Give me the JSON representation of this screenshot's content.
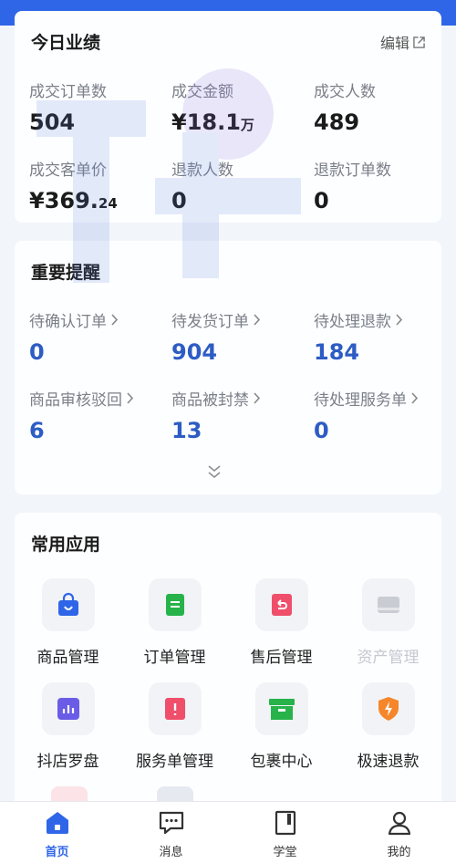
{
  "performance": {
    "title": "今日业绩",
    "edit_label": "编辑",
    "metrics": [
      {
        "label": "成交订单数",
        "value": "504",
        "suffix": ""
      },
      {
        "label": "成交金额",
        "value": "¥18.1",
        "suffix": "万"
      },
      {
        "label": "成交人数",
        "value": "489",
        "suffix": ""
      },
      {
        "label": "成交客单价",
        "value": "¥369.",
        "suffix": "24"
      },
      {
        "label": "退款人数",
        "value": "0",
        "suffix": ""
      },
      {
        "label": "退款订单数",
        "value": "0",
        "suffix": ""
      }
    ]
  },
  "reminders": {
    "title": "重要提醒",
    "items": [
      {
        "label": "待确认订单",
        "value": "0"
      },
      {
        "label": "待发货订单",
        "value": "904"
      },
      {
        "label": "待处理退款",
        "value": "184"
      },
      {
        "label": "商品审核驳回",
        "value": "6"
      },
      {
        "label": "商品被封禁",
        "value": "13"
      },
      {
        "label": "待处理服务单",
        "value": "0"
      }
    ]
  },
  "apps": {
    "title": "常用应用",
    "items": [
      {
        "label": "商品管理",
        "icon": "shopping-bag-icon",
        "color": "#2f66e8"
      },
      {
        "label": "订单管理",
        "icon": "order-list-icon",
        "color": "#27b34a"
      },
      {
        "label": "售后管理",
        "icon": "after-sales-icon",
        "color": "#ef4f6a"
      },
      {
        "label": "资产管理",
        "icon": "asset-icon",
        "color": "#c9ccd2"
      },
      {
        "label": "抖店罗盘",
        "icon": "compass-chart-icon",
        "color": "#6b5ce7"
      },
      {
        "label": "服务单管理",
        "icon": "service-ticket-icon",
        "color": "#ef4f6a"
      },
      {
        "label": "包裹中心",
        "icon": "package-box-icon",
        "color": "#27b34a"
      },
      {
        "label": "极速退款",
        "icon": "fast-refund-icon",
        "color": "#f5862a"
      }
    ]
  },
  "tabbar": {
    "items": [
      {
        "label": "首页",
        "icon": "home-icon",
        "active": true
      },
      {
        "label": "消息",
        "icon": "message-icon",
        "active": false
      },
      {
        "label": "学堂",
        "icon": "book-icon",
        "active": false
      },
      {
        "label": "我的",
        "icon": "profile-icon",
        "active": false
      }
    ]
  },
  "colors": {
    "accent": "#2f66e8",
    "value_blue": "#2d5cc4",
    "muted": "#7a7f88"
  }
}
